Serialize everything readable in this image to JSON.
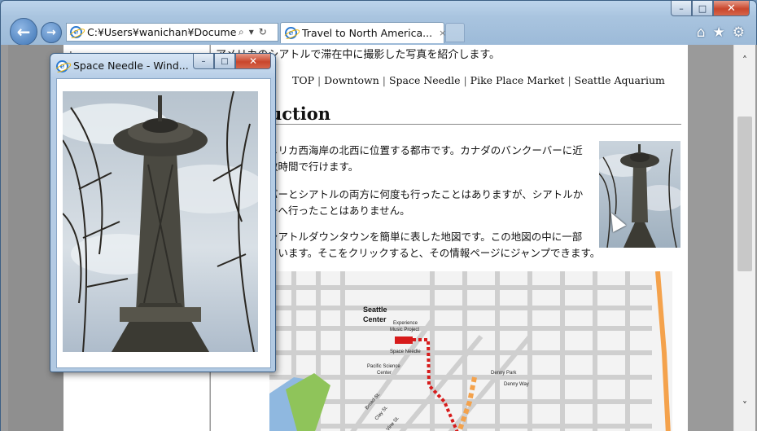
{
  "browser": {
    "address": "C:¥Users¥wanichan¥Document",
    "tab_title": "Travel to North America...",
    "tab_close": "×",
    "caption": {
      "minimize": "–",
      "maximize": "□",
      "close": "✕"
    },
    "nav": {
      "back": "←",
      "forward": "→"
    },
    "address_icons": {
      "search": "⌕",
      "dropdown": "▾",
      "refresh": "↻"
    },
    "tools": {
      "home": "⌂",
      "favorites": "★",
      "settings": "⚙"
    },
    "icons": [
      "ie-icon",
      "search-icon",
      "refresh-icon",
      "home-icon",
      "favorites-star-icon",
      "gear-icon"
    ]
  },
  "popup": {
    "title": "Space Needle - Wind...",
    "caption": {
      "minimize": "–",
      "maximize": "□",
      "close": "✕"
    }
  },
  "page": {
    "left_char": "ト",
    "intro": "アメリカのシアトルで滞在中に撮影した写真を紹介します。",
    "nav_links": [
      "TOP",
      "Downtown",
      "Space Needle",
      "Pike Place Market",
      "Seattle Aquarium"
    ],
    "nav_sep": " | ",
    "heading": "uction",
    "paragraphs": [
      [
        "メリカ西海岸の北西に位置する都市です。カナダのバンクーバーに近",
        "数時間で行けます。"
      ],
      [
        "バーとシアトルの両方に何度も行ったことはありますが、シアトルか",
        "ーへ行ったことはありません。"
      ],
      [
        "シアトルダウンタウンを簡単に表した地図です。この地図の中に一部",
        "ています。そこをクリックすると、その情報ページにジャンプできます。"
      ]
    ],
    "map_labels": {
      "seattle_center": [
        "Seattle",
        "Center"
      ],
      "emp": [
        "Experience",
        "Music Project"
      ],
      "space_needle": "Space Needle",
      "pacific_science": [
        "Pacific Science",
        "Center"
      ],
      "denny_park": "Denny Park",
      "denny_way": "Denny Way",
      "streets": [
        "Broad St.",
        "Clay St.",
        "Vine St."
      ]
    }
  },
  "scrollbar": {
    "up": "˄",
    "down": "˅"
  },
  "colors": {
    "map_street": "#cfcfcf",
    "map_route_red": "#d71b1b",
    "map_route_orange": "#f4a24c",
    "map_water": "#8fb8e0",
    "map_park": "#8fc45a"
  }
}
